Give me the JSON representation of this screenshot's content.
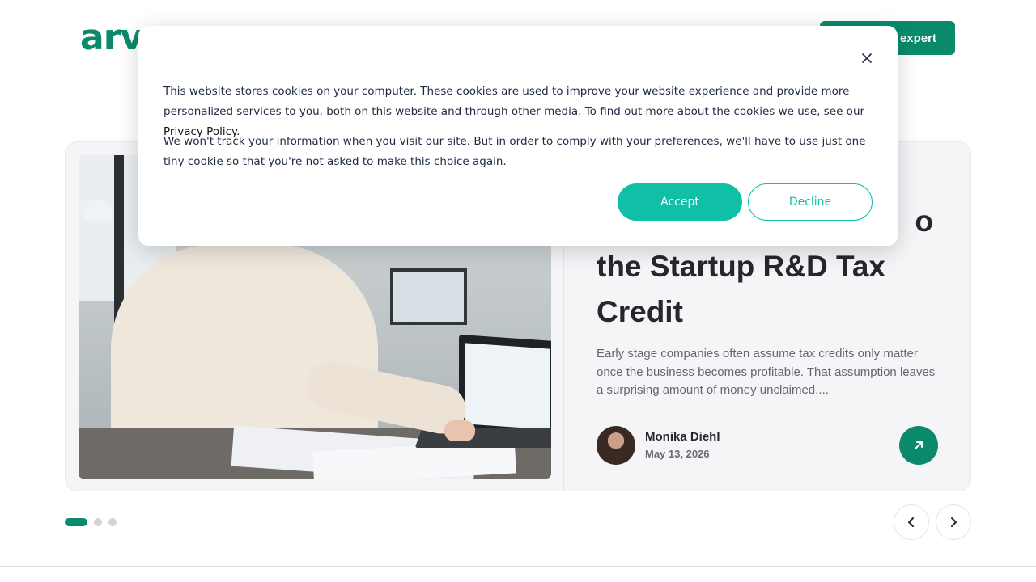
{
  "header": {
    "logo_text": "arve",
    "cta_label": "expert"
  },
  "post": {
    "title": "the Startup R&D Tax Credit",
    "title_partial_letter": "o",
    "excerpt": "Early stage companies often assume tax credits only matter once the business becomes profitable. That assumption leaves a surprising amount of money unclaimed....",
    "author_name": "Monika Diehl",
    "date": "May 13, 2026",
    "read_icon": "arrow-up-right-icon"
  },
  "carousel": {
    "active_index": 0,
    "total": 3,
    "prev_icon": "chevron-left-icon",
    "next_icon": "chevron-right-icon"
  },
  "cookie_banner": {
    "paragraph1": "This website stores cookies on your computer. These cookies are used to improve your website experience and provide more personalized services to you, both on this website and through other media. To find out more about the cookies we use, see our",
    "privacy_link": "Privacy Policy.",
    "paragraph2": "We won't track your information when you visit our site. But in order to comply with your preferences, we'll have to use just one tiny cookie so that you're not asked to make this choice again.",
    "accept_label": "Accept",
    "decline_label": "Decline",
    "close_icon": "close-icon"
  },
  "colors": {
    "brand_green": "#0a8a6a",
    "accept_teal": "#0fbfa6"
  }
}
